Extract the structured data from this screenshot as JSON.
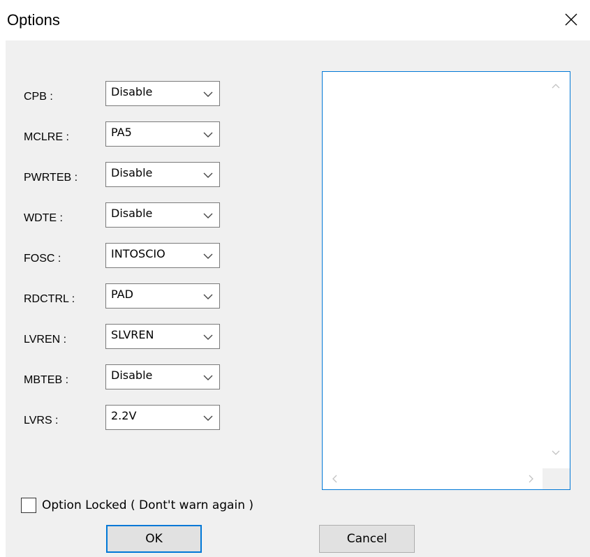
{
  "window": {
    "title": "Options"
  },
  "options": [
    {
      "label": "CPB :",
      "value": "Disable"
    },
    {
      "label": "MCLRE :",
      "value": "PA5"
    },
    {
      "label": "PWRTEB :",
      "value": "Disable"
    },
    {
      "label": "WDTE :",
      "value": "Disable"
    },
    {
      "label": "FOSC :",
      "value": "INTOSCIO"
    },
    {
      "label": "RDCTRL :",
      "value": "PAD"
    },
    {
      "label": "LVREN :",
      "value": "SLVREN"
    },
    {
      "label": "MBTEB :",
      "value": "Disable"
    },
    {
      "label": "LVRS :",
      "value": "2.2V"
    }
  ],
  "checkbox": {
    "label": "Option Locked ( Dont't warn again )",
    "checked": false
  },
  "buttons": {
    "ok": "OK",
    "cancel": "Cancel"
  },
  "colors": {
    "accent": "#0078d7",
    "dialog_bg": "#f0f0f0"
  },
  "icons": {
    "close": "close-icon",
    "dropdown": "chevron-down-icon"
  }
}
